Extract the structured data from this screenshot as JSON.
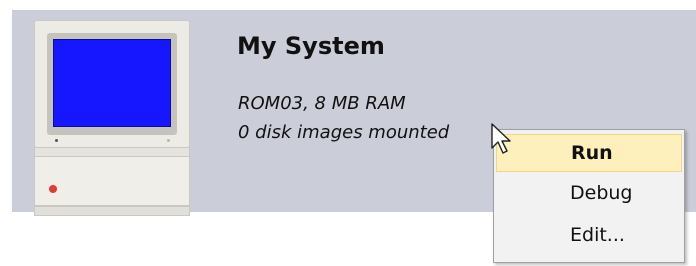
{
  "system": {
    "name": "My System",
    "rom_ram": "ROM03, 8 MB RAM",
    "disks": "0 disk images mounted"
  },
  "context_menu": {
    "items": [
      {
        "label": "Run",
        "highlighted": true
      },
      {
        "label": "Debug"
      },
      {
        "label": "Edit..."
      }
    ]
  },
  "colors": {
    "panel_bg": "#cbcdd9",
    "screen": "#1616ff",
    "menu_highlight": "#fdf0bd"
  },
  "icons": {
    "computer": "apple-iigs-computer-icon",
    "cursor": "mouse-pointer-icon"
  }
}
